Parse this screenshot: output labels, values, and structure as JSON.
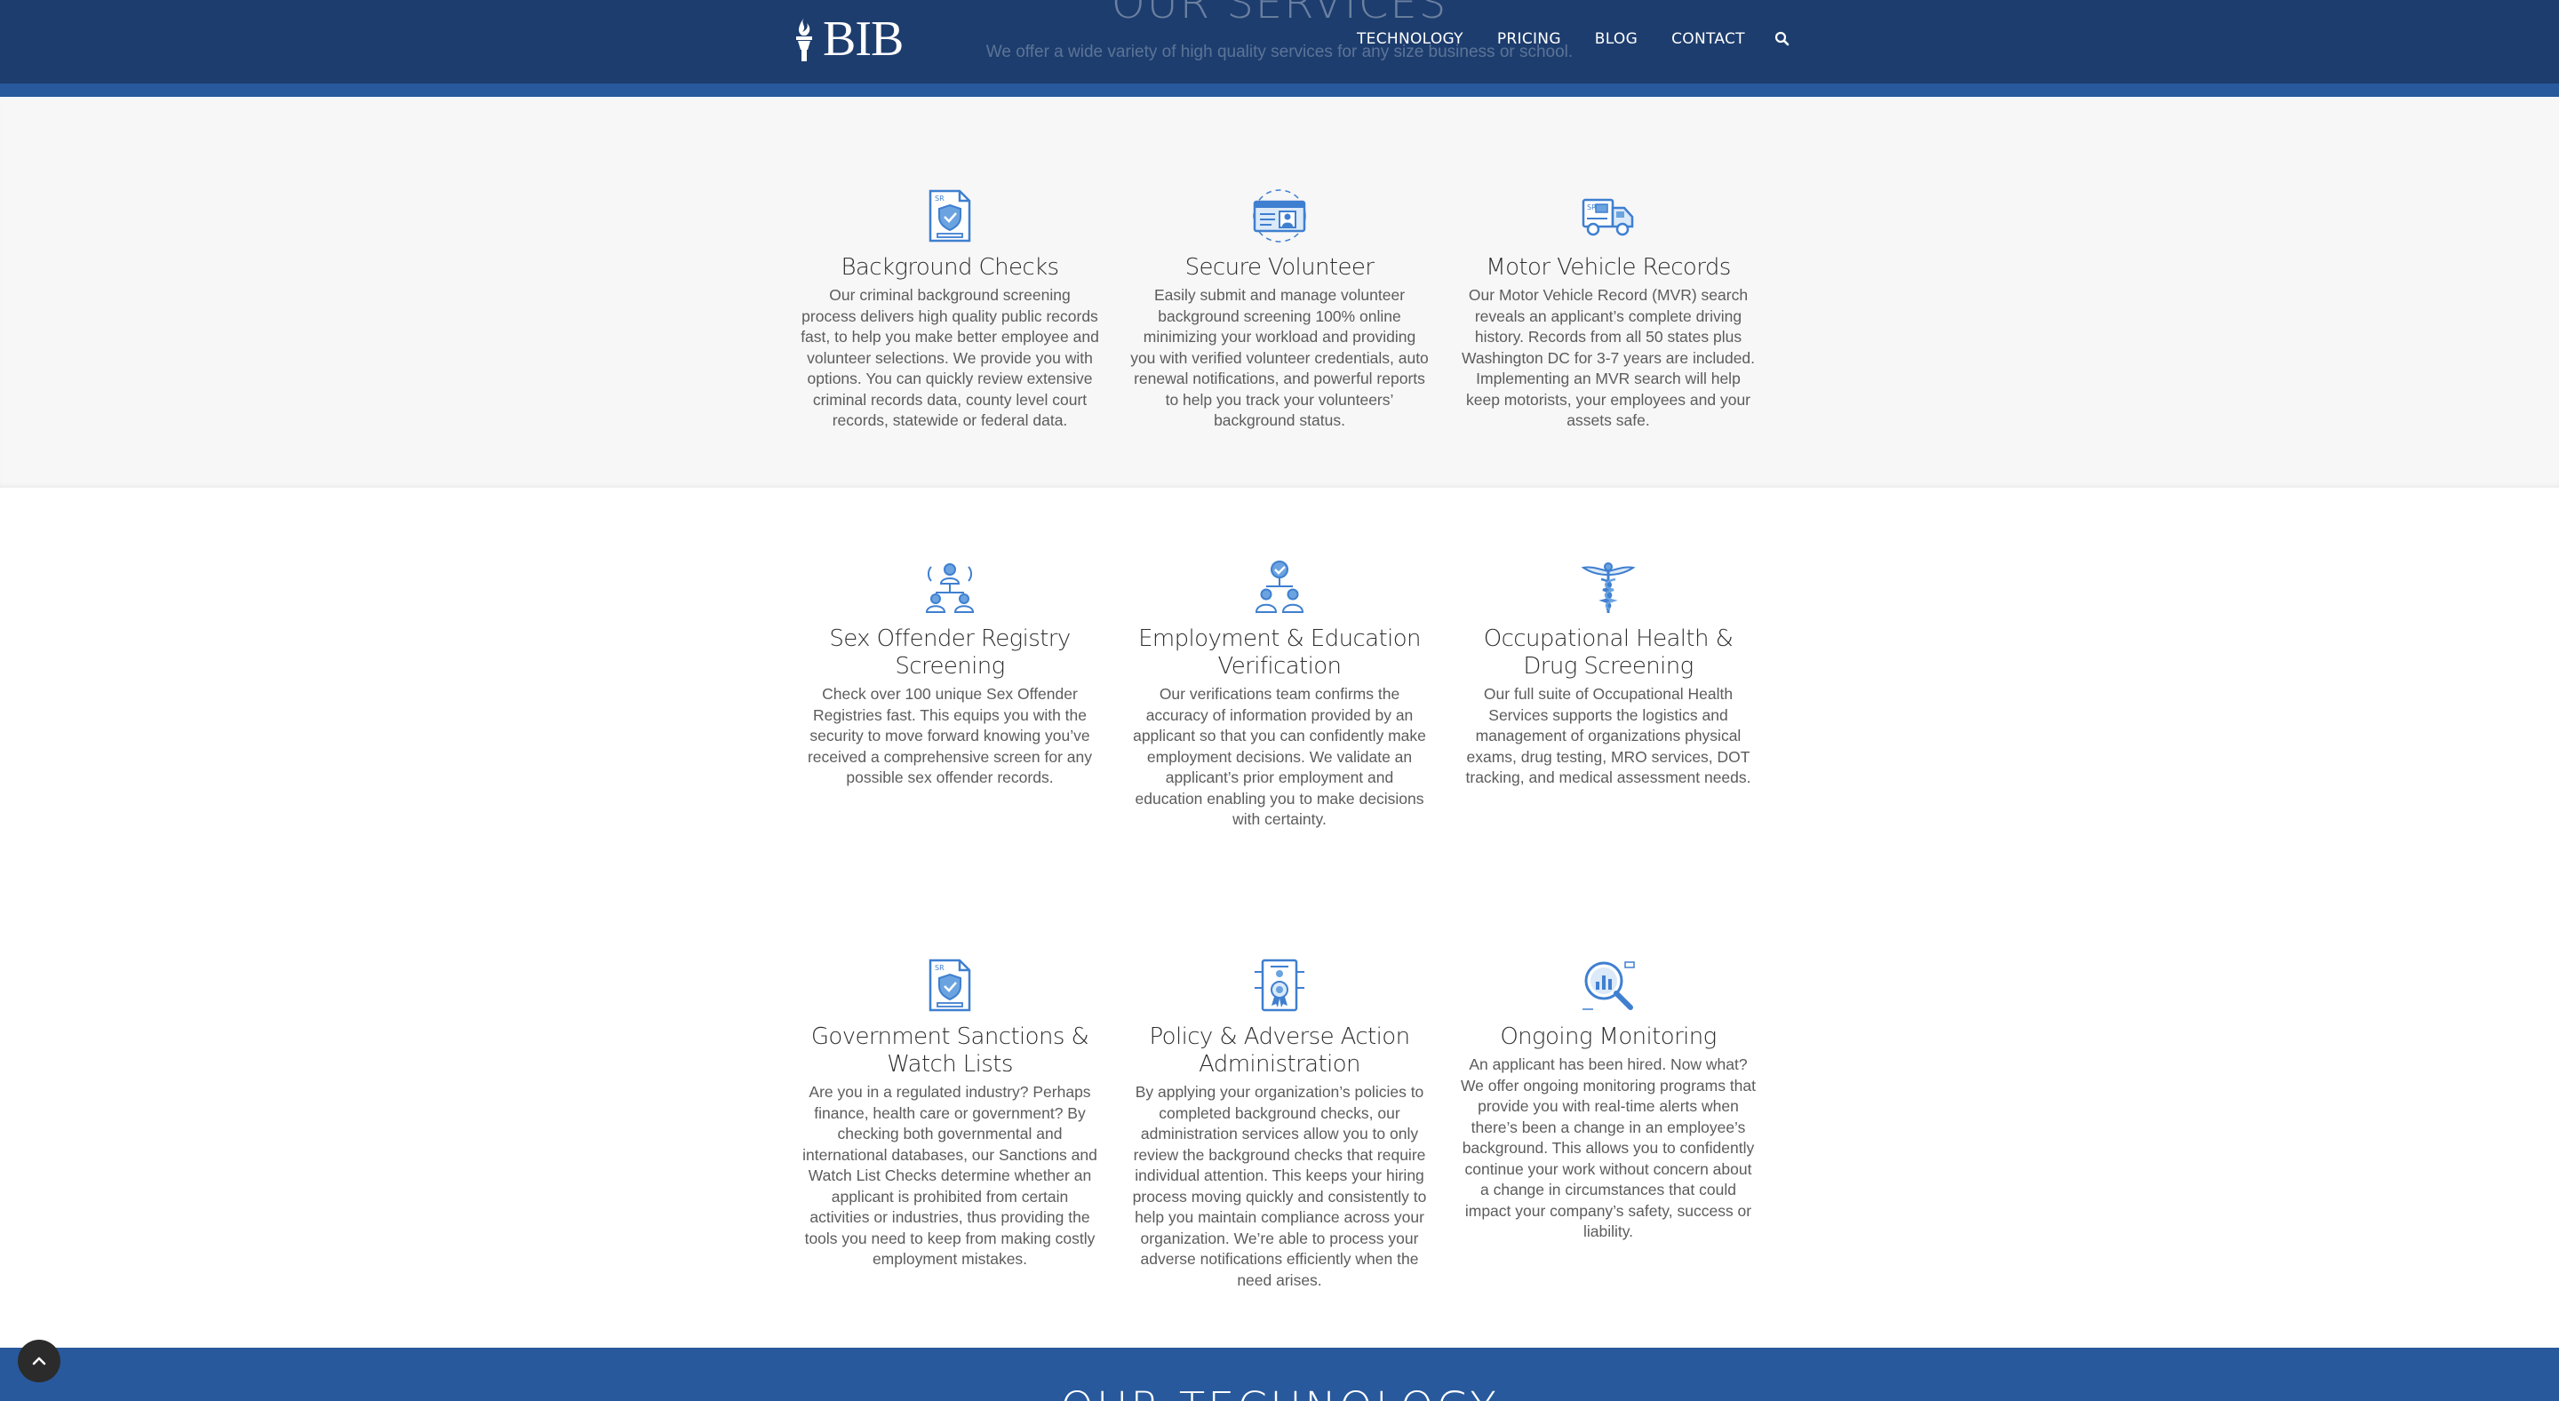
{
  "header": {
    "logo_text": "BIB",
    "ghost_title": "OUR SERVICES",
    "ghost_subtitle": "We offer a wide variety of high quality services for any size business or school.",
    "nav": [
      {
        "label": "TECHNOLOGY"
      },
      {
        "label": "PRICING"
      },
      {
        "label": "BLOG"
      },
      {
        "label": "CONTACT"
      }
    ],
    "search_icon": "search-icon"
  },
  "colors": {
    "header_bg": "#1d3d6e",
    "accent_blue": "#28599c",
    "icon_blue": "#3f7fd0"
  },
  "services": [
    {
      "title": "Background Checks",
      "icon": "document-shield-icon",
      "text": "Our criminal background screening process delivers high quality public records fast, to help you make better employee and volunteer selections. We provide you with options. You can quickly review extensive criminal records data, county level court records, statewide or federal data."
    },
    {
      "title": "Secure Volunteer",
      "icon": "id-card-icon",
      "text": "Easily submit and manage volunteer background screening 100% online minimizing your workload and providing you with verified volunteer credentials, auto renewal notifications, and powerful reports to help you track your volunteers’ background status."
    },
    {
      "title": "Motor Vehicle Records",
      "icon": "truck-icon",
      "text": "Our Motor Vehicle Record (MVR) search reveals an applicant’s complete driving history. Records from all 50 states plus Washington DC for 3-7 years are included. Implementing an MVR search will help keep motorists, your employees and your assets safe."
    },
    {
      "title": "Sex Offender Registry Screening",
      "icon": "people-network-icon",
      "text": "Check over 100 unique Sex Offender Registries fast. This equips you with the security to move forward knowing you’ve received a comprehensive screen for any possible sex offender records."
    },
    {
      "title": "Employment & Education Verification",
      "icon": "verified-people-icon",
      "text": "Our verifications team confirms the accuracy of information provided by an applicant so that you can confidently make employment decisions. We validate an applicant’s prior employment and education enabling you to make decisions with certainty."
    },
    {
      "title": "Occupational Health & Drug Screening",
      "icon": "caduceus-icon",
      "text": "Our full suite of Occupational Health Services supports the logistics and management of organizations physical exams, drug testing, MRO services, DOT tracking, and medical assessment needs."
    },
    {
      "title": "Government Sanctions & Watch Lists",
      "icon": "document-shield-icon",
      "text": "Are you in a regulated industry? Perhaps finance, health care or government? By checking both governmental and international databases, our Sanctions and Watch List Checks determine whether an applicant is prohibited from certain activities or industries, thus providing the tools you need to keep from making costly employment mistakes."
    },
    {
      "title": "Policy & Adverse Action Administration",
      "icon": "certificate-icon",
      "text": "By applying your organization’s policies to completed background checks, our administration services allow you to only review the background checks that require individual attention. This keeps your hiring process moving quickly and consistently to help you maintain compliance across your organization. We’re able to process your adverse notifications efficiently when the need arises."
    },
    {
      "title": "Ongoing Monitoring",
      "icon": "magnifier-chart-icon",
      "text": "An applicant has been hired. Now what? We offer ongoing monitoring programs that provide you with real-time alerts when there’s been a change in an employee’s background. This allows you to confidently continue your work without concern about a change in circumstances that could impact your company’s safety, success or liability."
    }
  ],
  "footer": {
    "title": "OUR TECHNOLOGY"
  },
  "scroll_top_icon": "chevron-up-icon"
}
